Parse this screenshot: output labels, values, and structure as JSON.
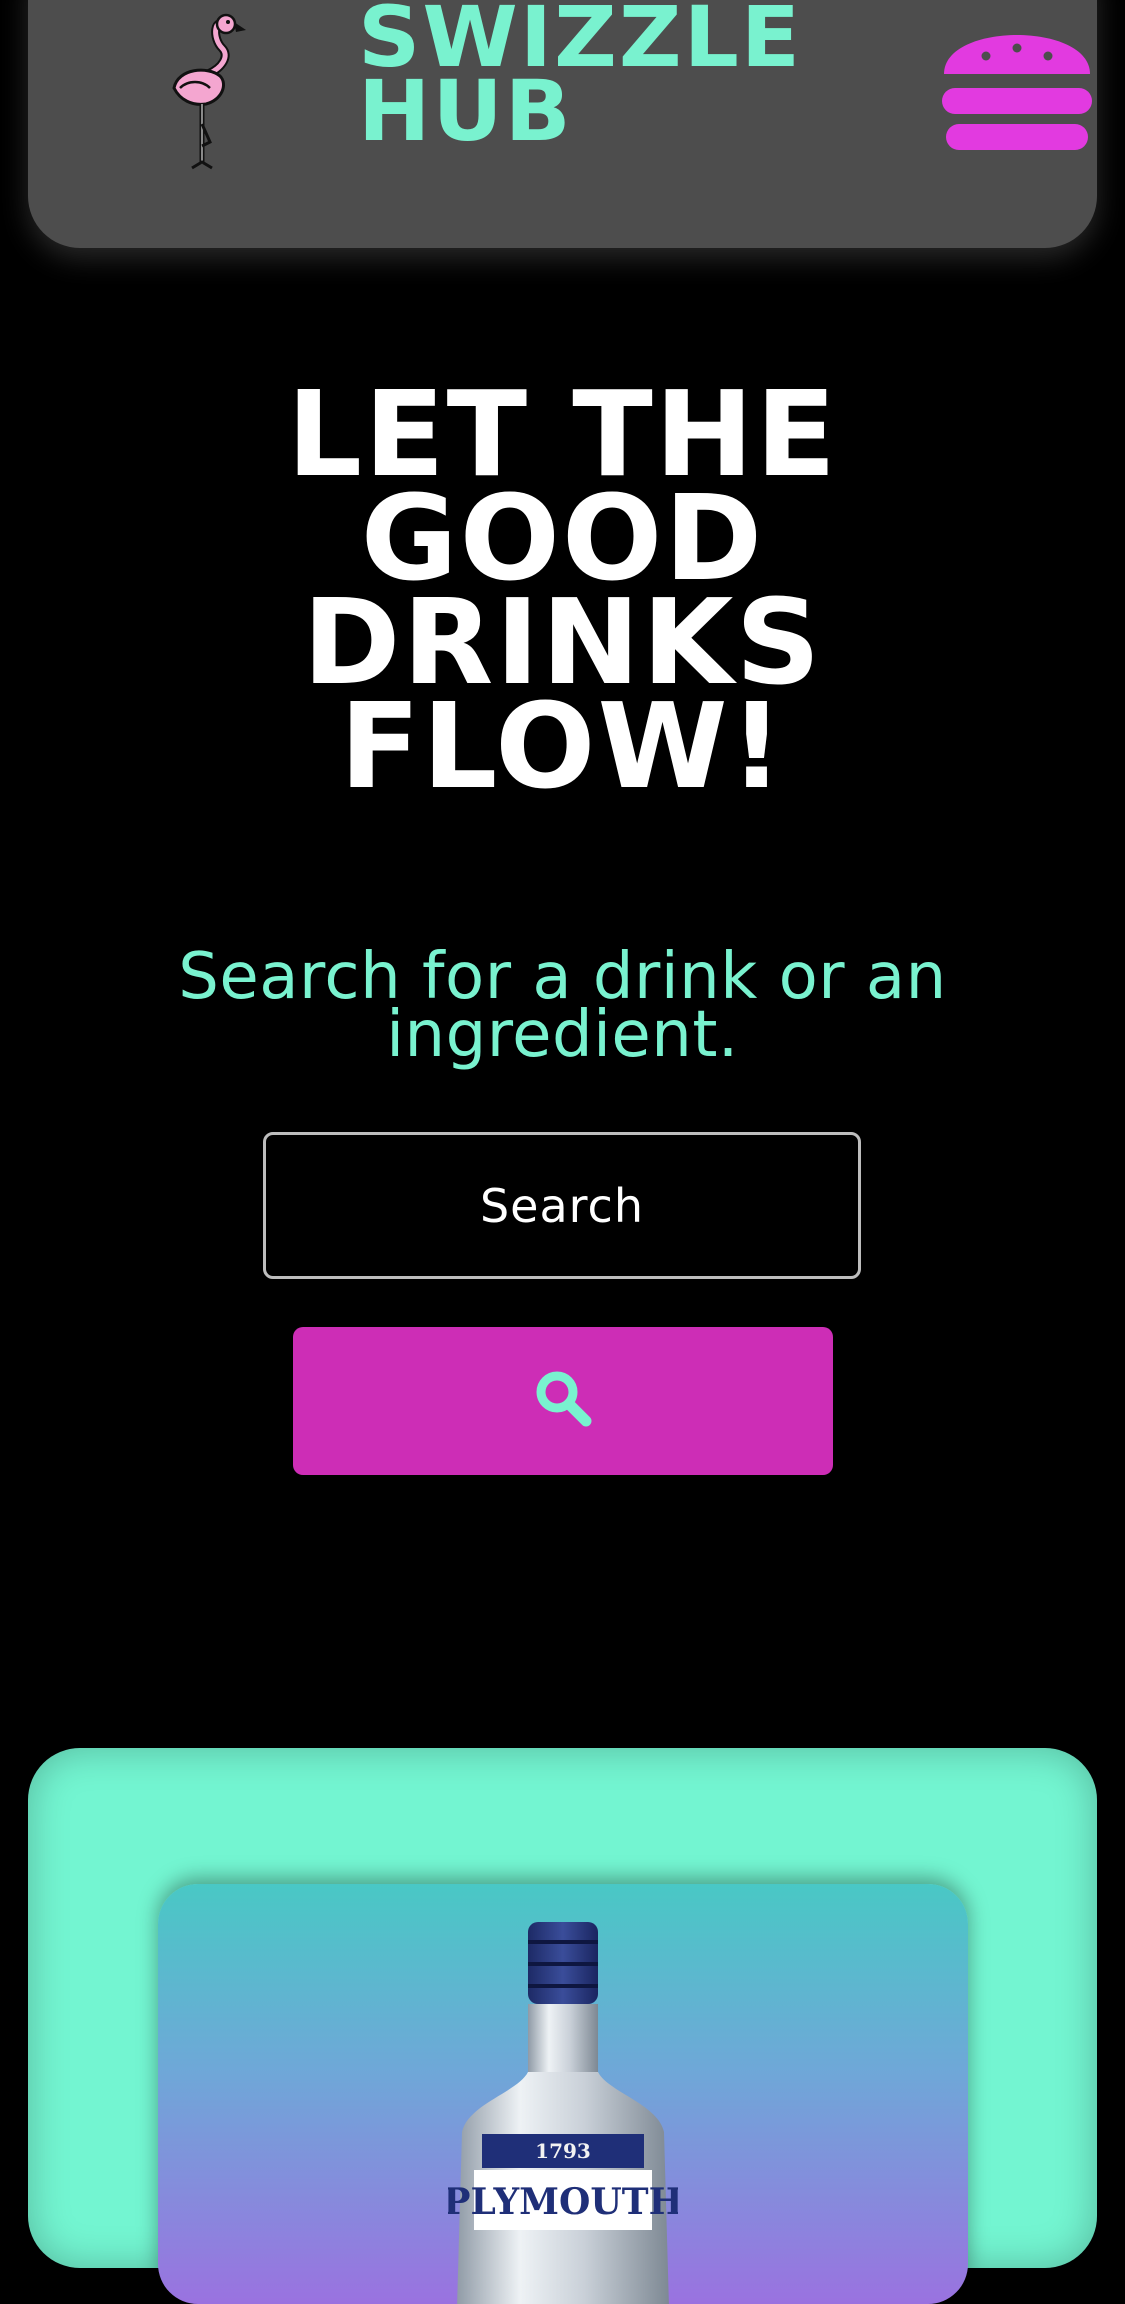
{
  "header": {
    "brand_line1": "SWIZZLE",
    "brand_line2": "HUB",
    "logo_icon": "flamingo-icon",
    "menu_icon": "burger-menu-icon"
  },
  "hero": {
    "line1": "LET THE",
    "line2": "GOOD",
    "line3": "DRINKS",
    "line4": "FLOW!"
  },
  "search": {
    "prompt_line1": "Search for a drink or an",
    "prompt_line2": "ingredient.",
    "placeholder": "Search",
    "button_icon": "search-icon"
  },
  "featured": {
    "bottle_year": "1793",
    "bottle_brand": "PLYMOUTH"
  },
  "colors": {
    "header_bg": "#4d4d4d",
    "accent_mint": "#79f2cf",
    "accent_magenta": "#cd2db6",
    "burger_magenta": "#e23ae0",
    "page_bg": "#000000"
  }
}
